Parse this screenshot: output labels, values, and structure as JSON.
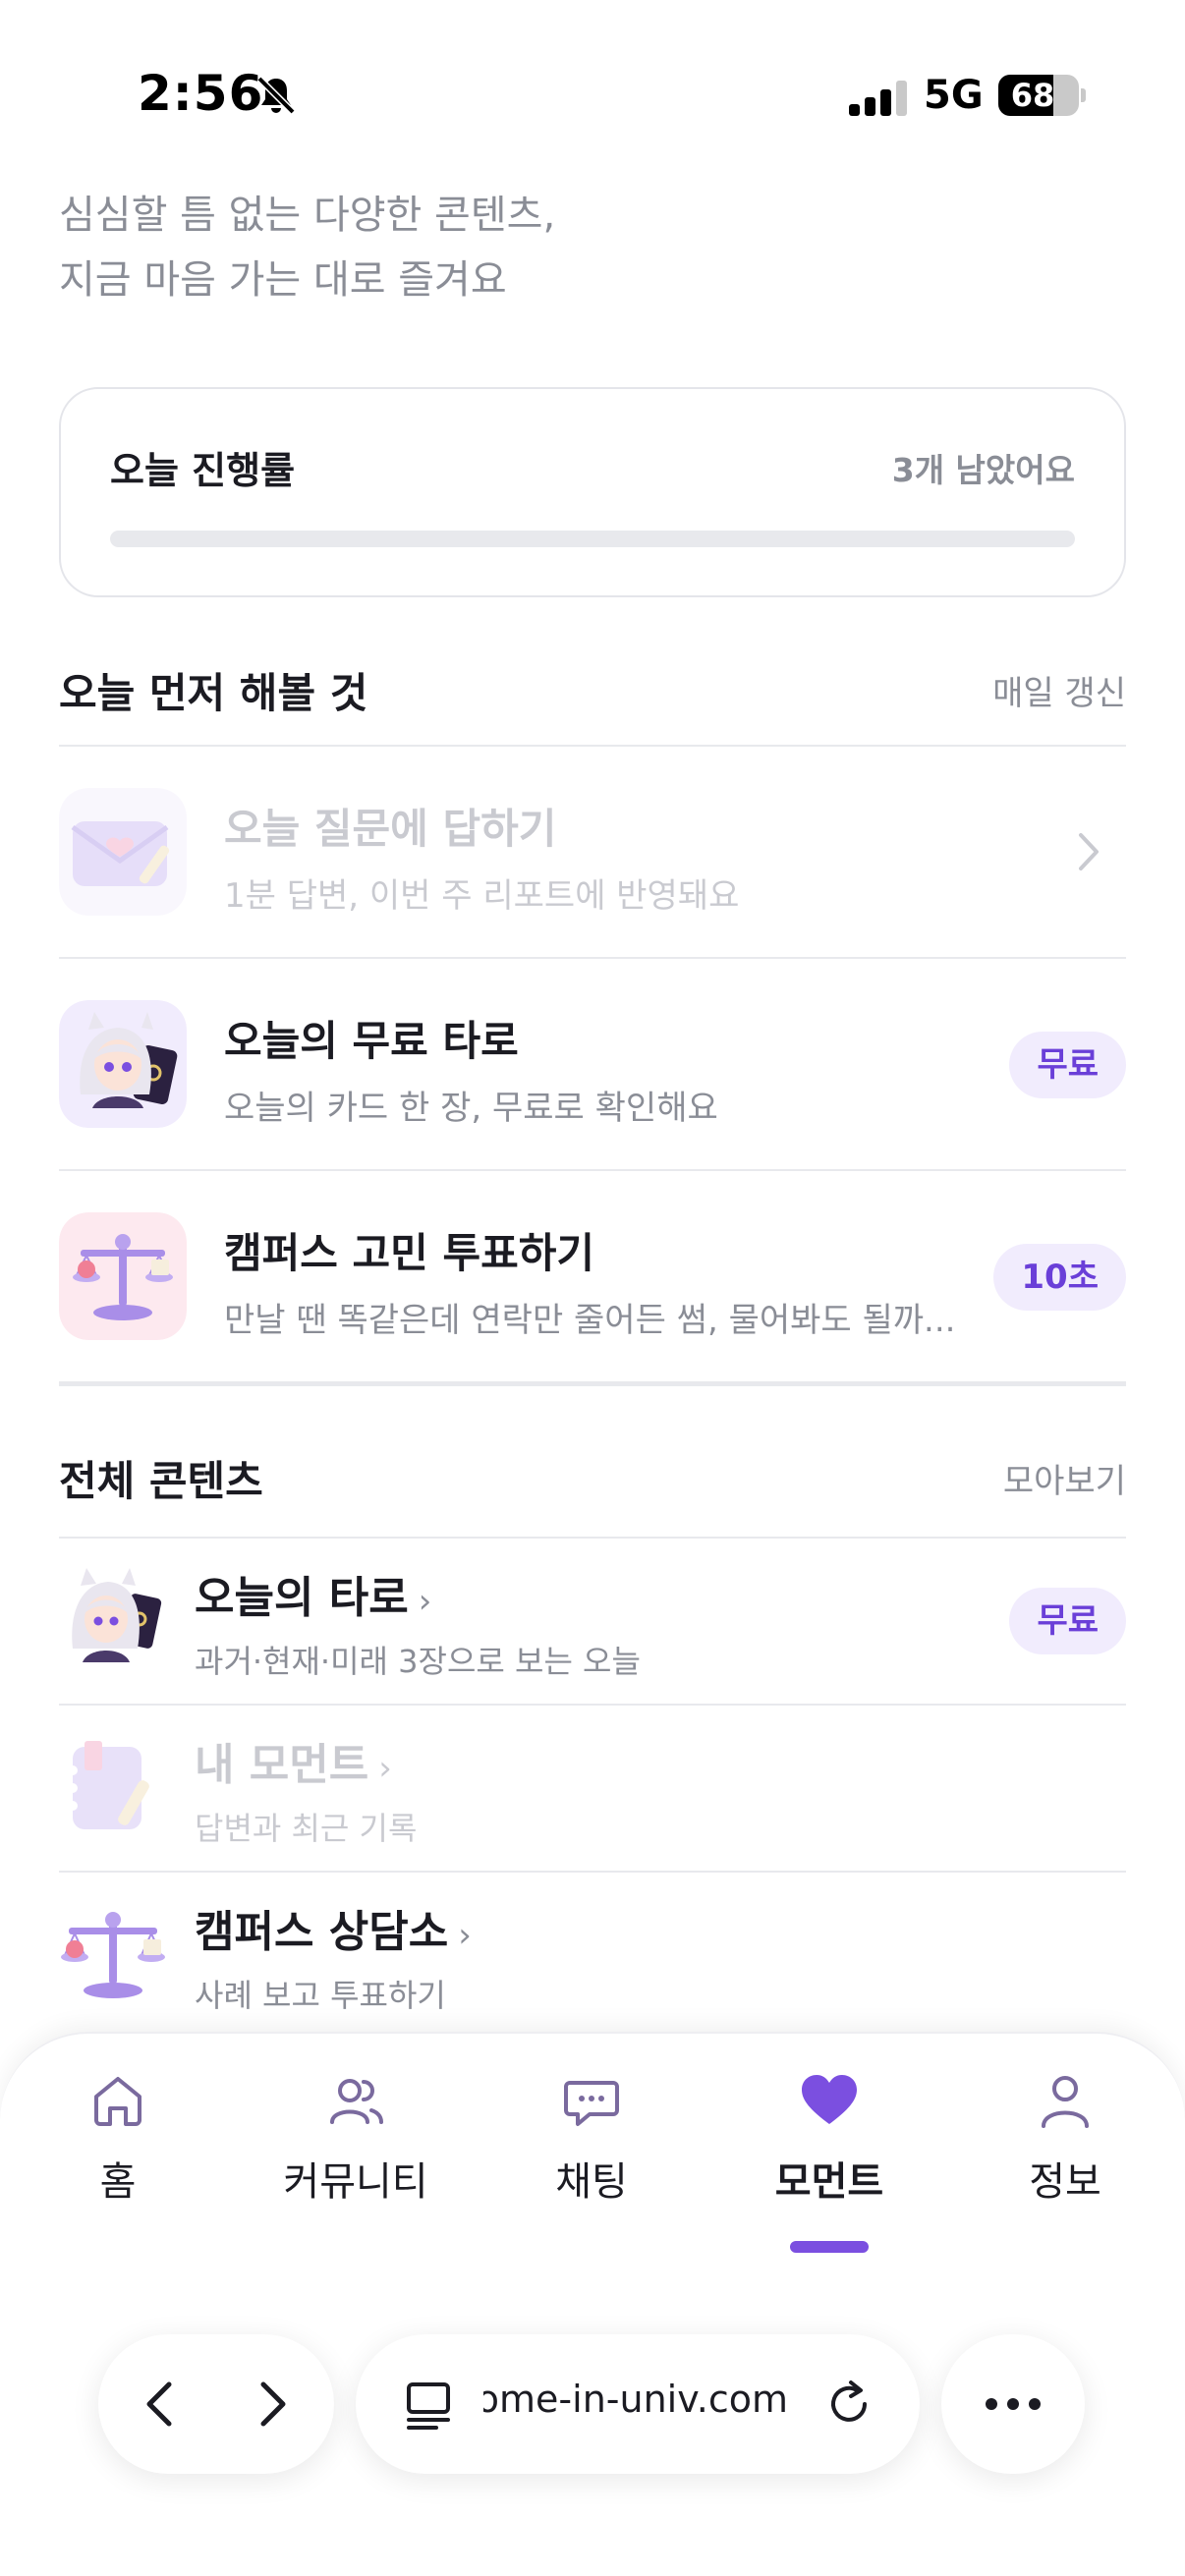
{
  "status_bar": {
    "time": "2:56",
    "network": "5G",
    "battery": "68",
    "battery_level": 0.68
  },
  "intro": {
    "line1": "심심할 틈 없는 다양한 콘텐츠,",
    "line2": "지금 마음 가는 대로 즐겨요"
  },
  "progress": {
    "title": "오늘 진행률",
    "remaining": "3개 남았어요",
    "value": 0
  },
  "today_section": {
    "title": "오늘 먼저 해볼 것",
    "action": "매일 갱신",
    "items": [
      {
        "title": "오늘 질문에 답하기",
        "subtitle": "1분 답변, 이번 주 리포트에 반영돼요",
        "icon": "envelope-heart-icon"
      },
      {
        "title": "오늘의 무료 타로",
        "subtitle": "오늘의 카드 한 장, 무료로 확인해요",
        "badge": "무료",
        "icon": "tarot-character-icon"
      },
      {
        "title": "캠퍼스 고민 투표하기",
        "subtitle": "만날 땐 똑같은데 연락만 줄어든 썸, 물어봐도 될까...",
        "badge": "10초",
        "icon": "balance-scale-icon"
      }
    ]
  },
  "all_section": {
    "title": "전체 콘텐츠",
    "action": "모아보기",
    "items": [
      {
        "title": "오늘의 타로",
        "arrow": "›",
        "subtitle": "과거·현재·미래 3장으로 보는 오늘",
        "badge": "무료",
        "icon": "tarot-character-icon"
      },
      {
        "title": "내 모먼트",
        "arrow": "›",
        "subtitle": "답변과 최근 기록",
        "icon": "notebook-icon"
      },
      {
        "title": "캠퍼스 상담소",
        "arrow": "›",
        "subtitle": "사례 보고 투표하기",
        "icon": "balance-scale-icon"
      }
    ]
  },
  "bottom_nav": {
    "items": [
      {
        "label": "홈",
        "icon": "home-icon"
      },
      {
        "label": "커뮤니티",
        "icon": "users-icon"
      },
      {
        "label": "채팅",
        "icon": "chat-bubble-icon"
      },
      {
        "label": "모먼트",
        "icon": "heart-icon",
        "active": true
      },
      {
        "label": "정보",
        "icon": "person-icon"
      }
    ],
    "accent_color": "#7b4fe0"
  },
  "browser": {
    "url": "welcome-in-univ.com"
  }
}
